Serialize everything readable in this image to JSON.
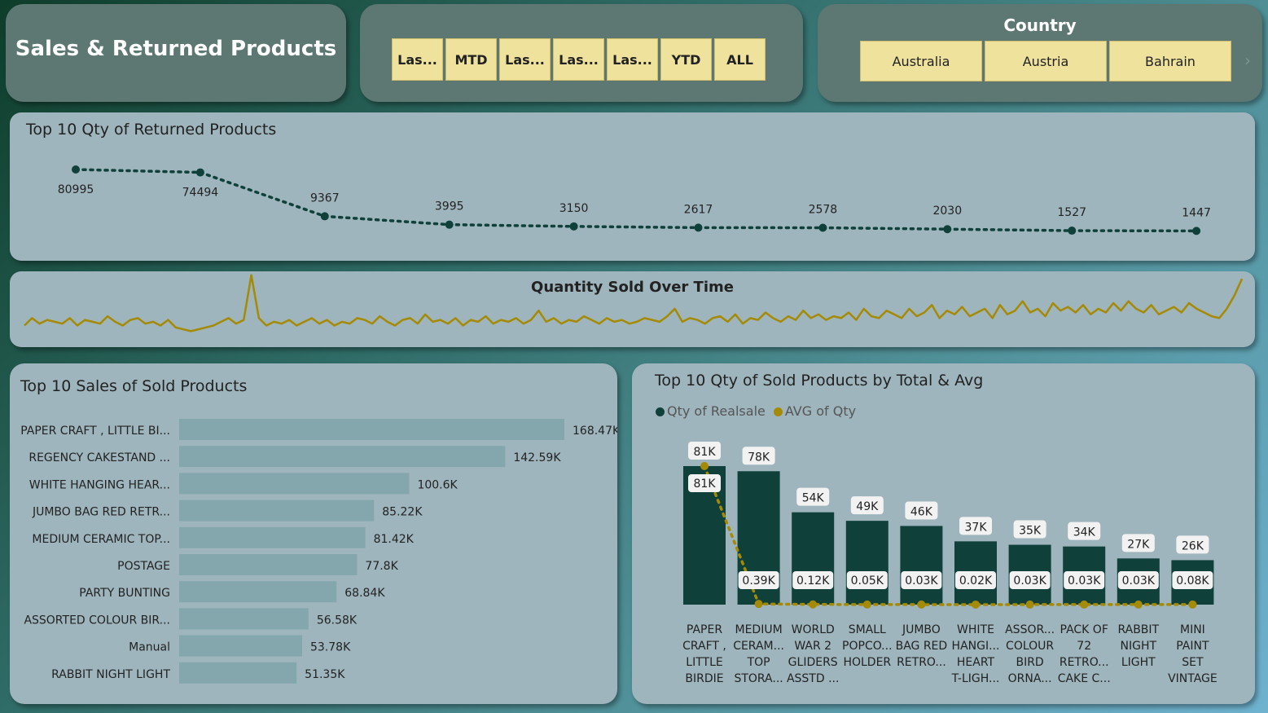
{
  "header": {
    "title": "Sales & Returned Products"
  },
  "date_slicer": {
    "buttons": [
      "Las...",
      "MTD",
      "Las...",
      "Las...",
      "Las...",
      "YTD",
      "ALL"
    ]
  },
  "country_slicer": {
    "title": "Country",
    "options": [
      "Australia",
      "Austria",
      "Bahrain"
    ],
    "next_icon": "chevron-right-icon"
  },
  "colors": {
    "dark_green": "#0f403a",
    "gold": "#a58a06",
    "bar": "#84a7ae",
    "slicer": "#efe29d"
  },
  "chart_data": [
    {
      "id": "returned",
      "type": "line",
      "title": "Top 10 Qty of Returned Products",
      "values": [
        80995,
        74494,
        9367,
        3995,
        3150,
        2617,
        2578,
        2030,
        1527,
        1447
      ],
      "data_labels": [
        "80995",
        "74494",
        "9367",
        "3995",
        "3150",
        "2617",
        "2578",
        "2030",
        "1527",
        "1447"
      ],
      "ylim": [
        0,
        80995
      ]
    },
    {
      "id": "over_time",
      "type": "line",
      "title": "Quantity Sold Over Time",
      "values": [
        5,
        9,
        6,
        8,
        7,
        6,
        9,
        5,
        8,
        7,
        6,
        10,
        7,
        5,
        8,
        9,
        6,
        7,
        5,
        8,
        4,
        3,
        2,
        3,
        4,
        5,
        7,
        9,
        6,
        8,
        32,
        9,
        5,
        7,
        6,
        8,
        5,
        7,
        9,
        6,
        8,
        5,
        7,
        6,
        9,
        8,
        6,
        10,
        7,
        5,
        8,
        9,
        6,
        11,
        7,
        8,
        6,
        9,
        5,
        8,
        7,
        10,
        6,
        8,
        7,
        9,
        6,
        8,
        13,
        7,
        9,
        6,
        8,
        7,
        10,
        8,
        6,
        9,
        7,
        8,
        6,
        7,
        9,
        8,
        7,
        10,
        14,
        7,
        9,
        8,
        6,
        9,
        10,
        7,
        11,
        6,
        9,
        8,
        12,
        9,
        7,
        10,
        8,
        13,
        9,
        11,
        8,
        10,
        9,
        12,
        8,
        14,
        10,
        9,
        13,
        11,
        9,
        14,
        10,
        12,
        16,
        9,
        13,
        11,
        15,
        10,
        12,
        14,
        9,
        16,
        11,
        13,
        18,
        12,
        14,
        10,
        17,
        13,
        15,
        12,
        16,
        11,
        14,
        12,
        17,
        13,
        18,
        14,
        12,
        16,
        11,
        13,
        15,
        12,
        17,
        14,
        12,
        10,
        9,
        14,
        21,
        30
      ],
      "ylim": [
        0,
        34
      ]
    },
    {
      "id": "sales",
      "type": "bar",
      "title": "Top 10 Sales of Sold Products",
      "categories": [
        "PAPER CRAFT , LITTLE BI...",
        "REGENCY CAKESTAND ...",
        "WHITE HANGING HEAR...",
        "JUMBO BAG RED RETR...",
        "MEDIUM CERAMIC TOP...",
        "POSTAGE",
        "PARTY BUNTING",
        "ASSORTED COLOUR BIR...",
        "Manual",
        "RABBIT NIGHT LIGHT"
      ],
      "values": [
        168470,
        142590,
        100600,
        85220,
        81420,
        77800,
        68840,
        56580,
        53780,
        51350
      ],
      "data_labels": [
        "168.47K",
        "142.59K",
        "100.6K",
        "85.22K",
        "81.42K",
        "77.8K",
        "68.84K",
        "56.58K",
        "53.78K",
        "51.35K"
      ],
      "xlim": [
        0,
        168470
      ]
    },
    {
      "id": "qty",
      "type": "bar",
      "title": "Top 10 Qty of Sold Products by Total & Avg",
      "legend": [
        "Qty of Realsale",
        "AVG of Qty"
      ],
      "categories": [
        [
          "PAPER",
          "CRAFT ,",
          "LITTLE",
          "BIRDIE"
        ],
        [
          "MEDIUM",
          "CERAM...",
          "TOP",
          "STORA..."
        ],
        [
          "WORLD",
          "WAR 2",
          "GLIDERS",
          "ASSTD ..."
        ],
        [
          "SMALL",
          "POPCO...",
          "HOLDER"
        ],
        [
          "JUMBO",
          "BAG RED",
          "RETRO..."
        ],
        [
          "WHITE",
          "HANGI...",
          "HEART",
          "T-LIGH..."
        ],
        [
          "ASSOR...",
          "COLOUR",
          "BIRD",
          "ORNA..."
        ],
        [
          "PACK OF",
          "72",
          "RETRO...",
          "CAKE C..."
        ],
        [
          "RABBIT",
          "NIGHT",
          "LIGHT"
        ],
        [
          "MINI",
          "PAINT",
          "SET",
          "VINTAGE"
        ]
      ],
      "series": [
        {
          "name": "Qty of Realsale",
          "values": [
            81000,
            78000,
            54000,
            49000,
            46000,
            37000,
            35000,
            34000,
            27000,
            26000
          ],
          "labels": [
            "81K",
            "78K",
            "54K",
            "49K",
            "46K",
            "37K",
            "35K",
            "34K",
            "27K",
            "26K"
          ]
        },
        {
          "name": "AVG of Qty",
          "values": [
            81000,
            390,
            120,
            50,
            30,
            20,
            30,
            30,
            30,
            80
          ],
          "labels": [
            "81K",
            "0.39K",
            "0.12K",
            "0.05K",
            "0.03K",
            "0.02K",
            "0.03K",
            "0.03K",
            "0.03K",
            "0.08K"
          ]
        }
      ],
      "ylim": [
        0,
        81000
      ]
    }
  ]
}
